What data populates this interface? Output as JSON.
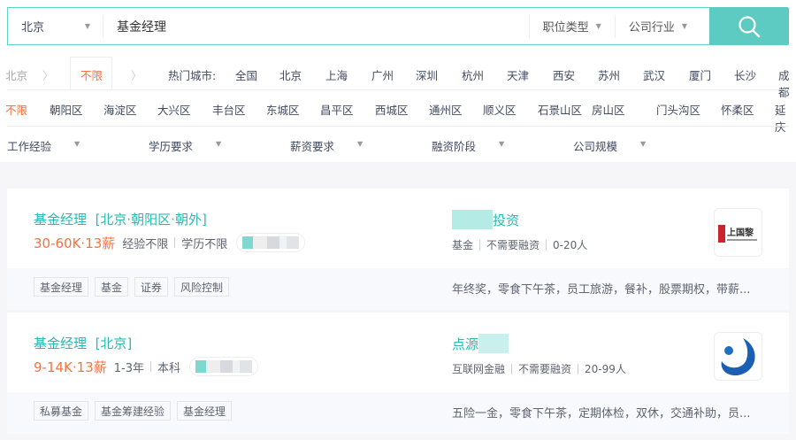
{
  "search": {
    "city": "北京",
    "query": "基金经理",
    "job_type": "职位类型",
    "industry": "公司行业",
    "icon": "search-icon",
    "accent": "#5dcbc1"
  },
  "location": {
    "current": "北京",
    "selected": "不限",
    "hot_label": "热门城市:",
    "cities": [
      "全国",
      "北京",
      "上海",
      "广州",
      "深圳",
      "杭州",
      "天津",
      "西安",
      "苏州",
      "武汉",
      "厦门",
      "长沙",
      "成都"
    ]
  },
  "districts": {
    "selected": "不限",
    "items": [
      "朝阳区",
      "海淀区",
      "大兴区",
      "丰台区",
      "东城区",
      "昌平区",
      "西城区",
      "通州区",
      "顺义区",
      "石景山区",
      "房山区",
      "门头沟区",
      "怀柔区",
      "延庆"
    ]
  },
  "conditions": [
    "工作经验",
    "学历要求",
    "薪资要求",
    "融资阶段",
    "公司规模"
  ],
  "jobs": [
    {
      "title": "基金经理",
      "location": "[北京·朝阳区·朝外]",
      "salary": "30-60K·13薪",
      "experience": "经验不限",
      "education": "学历不限",
      "company": "投资",
      "company_info": [
        "基金",
        "不需要融资",
        "0-20人"
      ],
      "tags": [
        "基金经理",
        "基金",
        "证券",
        "风险控制"
      ],
      "welfare": "年终奖，零食下午茶，员工旅游，餐补，股票期权，带薪...",
      "logo_text": "上国黎"
    },
    {
      "title": "基金经理",
      "location": "[北京]",
      "salary": "9-14K·13薪",
      "experience": "1-3年",
      "education": "本科",
      "company": "点源",
      "company_info": [
        "互联网金融",
        "不需要融资",
        "20-99人"
      ],
      "tags": [
        "私募基金",
        "基金筹建经验",
        "基金经理"
      ],
      "welfare": "五险一金，零食下午茶，定期体检，双休，交通补助，员..."
    }
  ]
}
